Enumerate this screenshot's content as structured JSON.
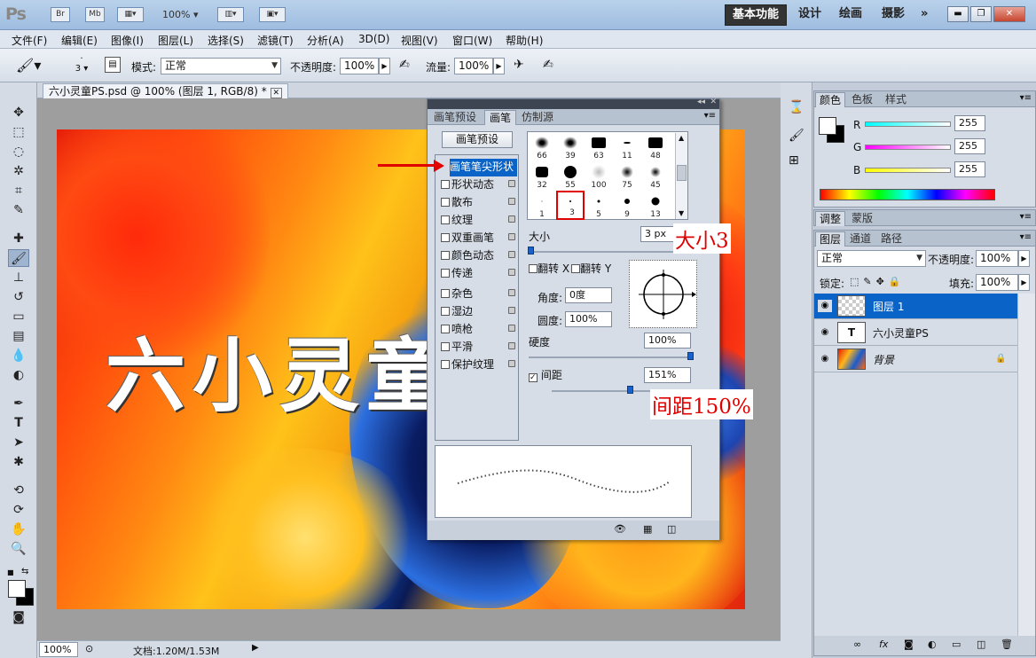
{
  "app": {
    "logo": "Ps",
    "bridge_button": "Br",
    "minibridge_button": "Mb",
    "zoom": "100%",
    "workspaces": [
      "基本功能",
      "设计",
      "绘画",
      "摄影"
    ],
    "more": "»"
  },
  "menu": [
    "文件(F)",
    "编辑(E)",
    "图像(I)",
    "图层(L)",
    "选择(S)",
    "滤镜(T)",
    "分析(A)",
    "3D(D)",
    "视图(V)",
    "窗口(W)",
    "帮助(H)"
  ],
  "options": {
    "brush_size": "3",
    "mode_label": "模式:",
    "mode_value": "正常",
    "opacity_label": "不透明度:",
    "opacity_value": "100%",
    "flow_label": "流量:",
    "flow_value": "100%"
  },
  "document": {
    "tab_title": "六小灵童PS.psd @ 100% (图层 1, RGB/8) *",
    "canvas_text": "六小灵童"
  },
  "status": {
    "zoom": "100%",
    "doc_info": "文档:1.20M/1.53M"
  },
  "brush_panel": {
    "tabs": [
      "画笔预设",
      "画笔",
      "仿制源"
    ],
    "active_tab": 1,
    "preset_button": "画笔预设",
    "options": [
      {
        "label": "画笔笔尖形状",
        "checkbox": false,
        "lock": false
      },
      {
        "label": "形状动态",
        "checkbox": true,
        "lock": true
      },
      {
        "label": "散布",
        "checkbox": true,
        "lock": true
      },
      {
        "label": "纹理",
        "checkbox": true,
        "lock": true
      },
      {
        "label": "双重画笔",
        "checkbox": true,
        "lock": true
      },
      {
        "label": "颜色动态",
        "checkbox": true,
        "lock": true
      },
      {
        "label": "传递",
        "checkbox": true,
        "lock": true
      },
      {
        "label": "杂色",
        "checkbox": true,
        "lock": true
      },
      {
        "label": "湿边",
        "checkbox": true,
        "lock": true
      },
      {
        "label": "喷枪",
        "checkbox": true,
        "lock": true
      },
      {
        "label": "平滑",
        "checkbox": true,
        "lock": true
      },
      {
        "label": "保护纹理",
        "checkbox": true,
        "lock": true
      }
    ],
    "brushes": [
      "66",
      "39",
      "63",
      "11",
      "48",
      "32",
      "55",
      "100",
      "75",
      "45",
      "1",
      "3",
      "5",
      "9",
      "13"
    ],
    "selected_brush": "3",
    "size_label": "大小",
    "size_value": "3 px",
    "flip_x": "翻转 X",
    "flip_y": "翻转 Y",
    "angle_label": "角度:",
    "angle_value": "0度",
    "roundness_label": "圆度:",
    "roundness_value": "100%",
    "hardness_label": "硬度",
    "hardness_value": "100%",
    "spacing_label": "间距",
    "spacing_value": "151%"
  },
  "annotations": {
    "size": "大小3",
    "spacing": "间距150%"
  },
  "color_panel": {
    "tabs": [
      "颜色",
      "色板",
      "样式"
    ],
    "channels": [
      {
        "label": "R",
        "value": "255"
      },
      {
        "label": "G",
        "value": "255"
      },
      {
        "label": "B",
        "value": "255"
      }
    ]
  },
  "adjust_panel": {
    "tabs": [
      "调整",
      "蒙版"
    ]
  },
  "layers_panel": {
    "tabs": [
      "图层",
      "通道",
      "路径"
    ],
    "blend_mode": "正常",
    "opacity_label": "不透明度:",
    "opacity_value": "100%",
    "lock_label": "锁定:",
    "fill_label": "填充:",
    "fill_value": "100%",
    "layers": [
      {
        "name": "图层 1",
        "selected": true,
        "thumb": "transparent"
      },
      {
        "name": "六小灵童PS",
        "selected": false,
        "thumb": "text"
      },
      {
        "name": "背景",
        "selected": false,
        "thumb": "image"
      }
    ],
    "footer_icons": [
      "link-icon",
      "fx-icon",
      "mask-icon",
      "adjustment-icon",
      "group-icon",
      "new-layer-icon",
      "trash-icon"
    ]
  },
  "colors": {
    "accent": "#0a64c8",
    "annotation": "#e10000"
  }
}
